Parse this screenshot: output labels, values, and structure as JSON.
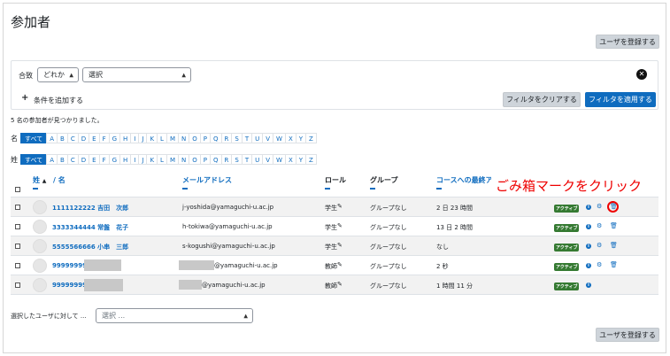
{
  "page": {
    "title": "参加者",
    "enrol_button": "ユーザを登録する",
    "enrol_button_bottom": "ユーザを登録する"
  },
  "filter": {
    "match_label": "合致",
    "match_value": "どれか",
    "type_value": "選択",
    "add_condition": "条件を追加する",
    "clear_button": "フィルタをクリアする",
    "apply_button": "フィルタを適用する"
  },
  "result_count": "5 名の参加者が見つかりました。",
  "initials": {
    "first_label": "名",
    "last_label": "姓",
    "all_label": "すべて",
    "letters": [
      "A",
      "B",
      "C",
      "D",
      "E",
      "F",
      "G",
      "H",
      "I",
      "J",
      "K",
      "L",
      "M",
      "N",
      "O",
      "P",
      "Q",
      "R",
      "S",
      "T",
      "U",
      "V",
      "W",
      "X",
      "Y",
      "Z"
    ]
  },
  "table": {
    "headers": {
      "last_name": "姓",
      "first_name": "/ 名",
      "email": "メールアドレス",
      "role": "ロール",
      "group": "グループ",
      "last_access": "コースへの最終アクセス"
    },
    "rows": [
      {
        "name": "1111122222 吉田　次郎",
        "email": "j-yoshida@yamaguchi-u.ac.jp",
        "role": "学生",
        "group": "グループなし",
        "last_access": "2 日 23 時間",
        "status": "アクティブ"
      },
      {
        "name": "3333344444 常盤　花子",
        "email": "h-tokiwa@yamaguchi-u.ac.jp",
        "role": "学生",
        "group": "グループなし",
        "last_access": "13 日 2 時間",
        "status": "アクティブ"
      },
      {
        "name": "5555566666 小串　三郎",
        "email": "s-kogushi@yamaguchi-u.ac.jp",
        "role": "学生",
        "group": "グループなし",
        "last_access": "なし",
        "status": "アクティブ"
      },
      {
        "name": "99999999",
        "email": "@yamaguchi-u.ac.jp",
        "role": "教師",
        "group": "グループなし",
        "last_access": "2 秒",
        "status": "アクティブ"
      },
      {
        "name": "99999999",
        "email": "@yamaguchi-u.ac.jp",
        "role": "教師",
        "group": "グループなし",
        "last_access": "1 時間 11 分",
        "status": "アクティブ"
      }
    ]
  },
  "bulk": {
    "label": "選択したユーザに対して ...",
    "placeholder": "選択 ..."
  },
  "annotation": "ごみ箱マークをクリック",
  "icons": {
    "sort": "sort-ascending-icon",
    "edit": "pencil-icon",
    "info": "info-icon",
    "settings": "gear-icon",
    "delete": "trash-icon",
    "remove_filter": "close-icon"
  },
  "colors": {
    "primary": "#0f6cbf",
    "active_badge": "#357a32",
    "annotation": "#ee0000"
  }
}
